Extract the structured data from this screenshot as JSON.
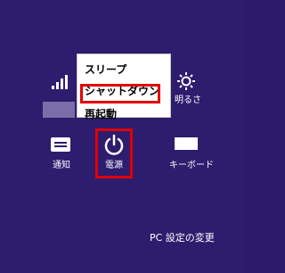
{
  "menu": {
    "items": [
      {
        "label": "スリープ"
      },
      {
        "label": "シャットダウン"
      },
      {
        "label": "再起動"
      }
    ]
  },
  "tiles": {
    "brightness_label": "明るさ",
    "notifications_label": "通知",
    "power_label": "電源",
    "keyboard_label": "キーボード"
  },
  "footer": {
    "change_pc_settings": "PC 設定の変更"
  },
  "colors": {
    "background": "#2e1c6e",
    "highlight": "#e00000",
    "menu_background": "#ffffff"
  },
  "icons": [
    "network-signal-icon",
    "brightness-icon",
    "notifications-icon",
    "power-icon",
    "keyboard-icon"
  ]
}
